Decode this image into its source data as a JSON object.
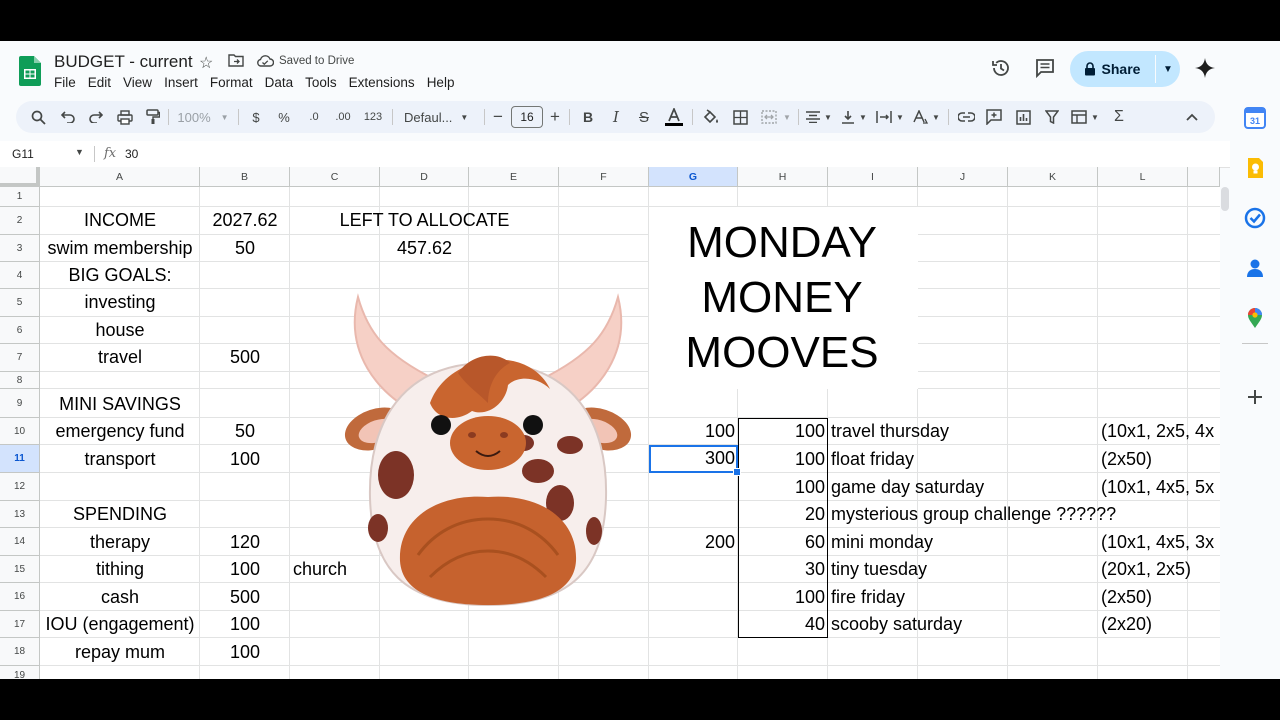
{
  "doc": {
    "title": "BUDGET - current",
    "saved_status": "Saved to Drive"
  },
  "menu": [
    "File",
    "Edit",
    "View",
    "Insert",
    "Format",
    "Data",
    "Tools",
    "Extensions",
    "Help"
  ],
  "share": {
    "label": "Share"
  },
  "toolbar": {
    "zoom": "100%",
    "currency": "$",
    "percent": "%",
    "decrease_decimal": ".0",
    "increase_decimal": ".00",
    "number_format": "123",
    "font": "Defaul...",
    "font_size": "16"
  },
  "formula_bar": {
    "cell_ref": "G11",
    "value": "30",
    "fx": "fx"
  },
  "grid": {
    "columns": [
      "A",
      "B",
      "C",
      "D",
      "E",
      "F",
      "G",
      "H",
      "I",
      "J",
      "K",
      "L"
    ],
    "selected_column": "G",
    "rows": [
      "1",
      "2",
      "3",
      "4",
      "5",
      "6",
      "7",
      "8",
      "9",
      "10",
      "11",
      "12",
      "13",
      "14",
      "15",
      "16",
      "17",
      "18",
      "19"
    ],
    "selected_row": "11"
  },
  "cells": {
    "A2": "INCOME",
    "B2": "2027.62",
    "CD2": "LEFT TO ALLOCATE",
    "A3": "swim membership",
    "B3": "50",
    "D3": "457.62",
    "A4": "BIG GOALS:",
    "A5": "investing",
    "A6": "house",
    "A7": "travel",
    "B7": "500",
    "A9": "MINI SAVINGS",
    "A10": "emergency fund",
    "B10": "50",
    "G10": "100",
    "H10": "100",
    "I10": "travel thursday",
    "L10": "(10x1, 2x5, 4x",
    "A11": "transport",
    "B11": "100",
    "G11": "300",
    "H11": "100",
    "I11": "float friday",
    "L11": "(2x50)",
    "H12": "100",
    "I12": "game day saturday",
    "L12": "(10x1, 4x5, 5x",
    "A13": "SPENDING",
    "H13": "20",
    "I13": "mysterious group challenge ??????",
    "A14": "therapy",
    "B14": "120",
    "G14": "200",
    "H14": "60",
    "I14": "mini monday",
    "L14": "(10x1, 4x5, 3x",
    "A15": "tithing",
    "B15": "100",
    "C15": "church",
    "H15": "30",
    "I15": "tiny tuesday",
    "L15": "(20x1, 2x5)",
    "A16": "cash",
    "B16": "500",
    "H16": "100",
    "I16": "fire friday",
    "L16": "(2x50)",
    "A17": "IOU (engagement)",
    "B17": "100",
    "H17": "40",
    "I17": "scooby saturday",
    "L17": "(2x20)",
    "A18": "repay mum",
    "B18": "100"
  },
  "overlay": {
    "mooves_title": "MONDAY\nMONEY\nMOOVES"
  },
  "colors": {
    "accent": "#1a73e8",
    "share_bg": "#c2e7ff",
    "sheets_green": "#0f9d58",
    "header_selected": "#d3e3fd"
  }
}
